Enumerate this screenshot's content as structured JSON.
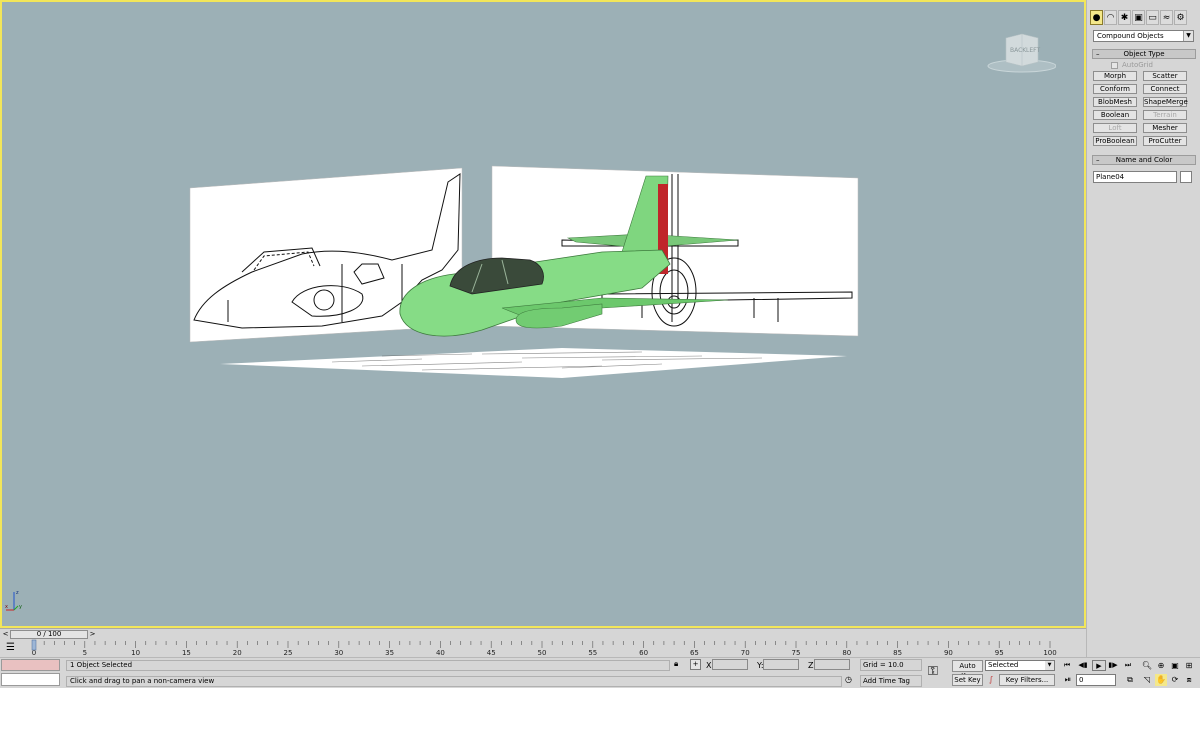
{
  "viewport": {
    "viewcube_face_back": "BACK",
    "viewcube_face_left": "LEFT",
    "axis_z": "z",
    "axis_x": "x",
    "axis_y": "y",
    "background_color": "#9cb0b6",
    "active_border_color": "#f2e65a"
  },
  "command_panel": {
    "category_dropdown": "Compound Objects",
    "object_type_title": "Object Type",
    "autogrid_label": "AutoGrid",
    "buttons": [
      {
        "label": "Morph",
        "enabled": true
      },
      {
        "label": "Scatter",
        "enabled": true
      },
      {
        "label": "Conform",
        "enabled": true
      },
      {
        "label": "Connect",
        "enabled": true
      },
      {
        "label": "BlobMesh",
        "enabled": true
      },
      {
        "label": "ShapeMerge",
        "enabled": true
      },
      {
        "label": "Boolean",
        "enabled": true
      },
      {
        "label": "Terrain",
        "enabled": false
      },
      {
        "label": "Loft",
        "enabled": false
      },
      {
        "label": "Mesher",
        "enabled": true
      },
      {
        "label": "ProBoolean",
        "enabled": true
      },
      {
        "label": "ProCutter",
        "enabled": true
      }
    ],
    "name_color_title": "Name and Color",
    "object_name": "Plane04",
    "tab_icons": [
      "geometry-icon",
      "shapes-icon",
      "lights-icon",
      "cameras-icon",
      "helpers-icon",
      "spacewarps-icon",
      "systems-icon"
    ]
  },
  "timeslider": {
    "frame_label": "0 / 100",
    "prev": "<",
    "next": ">"
  },
  "trackbar": {
    "ticks": [
      "0",
      "5",
      "10",
      "15",
      "20",
      "25",
      "30",
      "35",
      "40",
      "45",
      "50",
      "55",
      "60",
      "65",
      "70",
      "75",
      "80",
      "85",
      "90",
      "95",
      "100"
    ]
  },
  "status": {
    "selection": "1 Object Selected",
    "prompt": "Click and drag to pan a non-camera view",
    "x_label": "X:",
    "y_label": "Y:",
    "z_label": "Z:",
    "grid": "Grid = 10.0",
    "add_time_tag": "Add Time Tag",
    "auto_key": "Auto Key",
    "set_key": "Set Key",
    "selected_dropdown": "Selected",
    "key_filters": "Key Filters...",
    "current_frame": "0"
  },
  "colors": {
    "aircraft_green": "#7fd67f",
    "tail_stripe": "#c0262a",
    "panel_bg": "#d6d6d6",
    "maxscript_pink": "#e9c1c1"
  }
}
